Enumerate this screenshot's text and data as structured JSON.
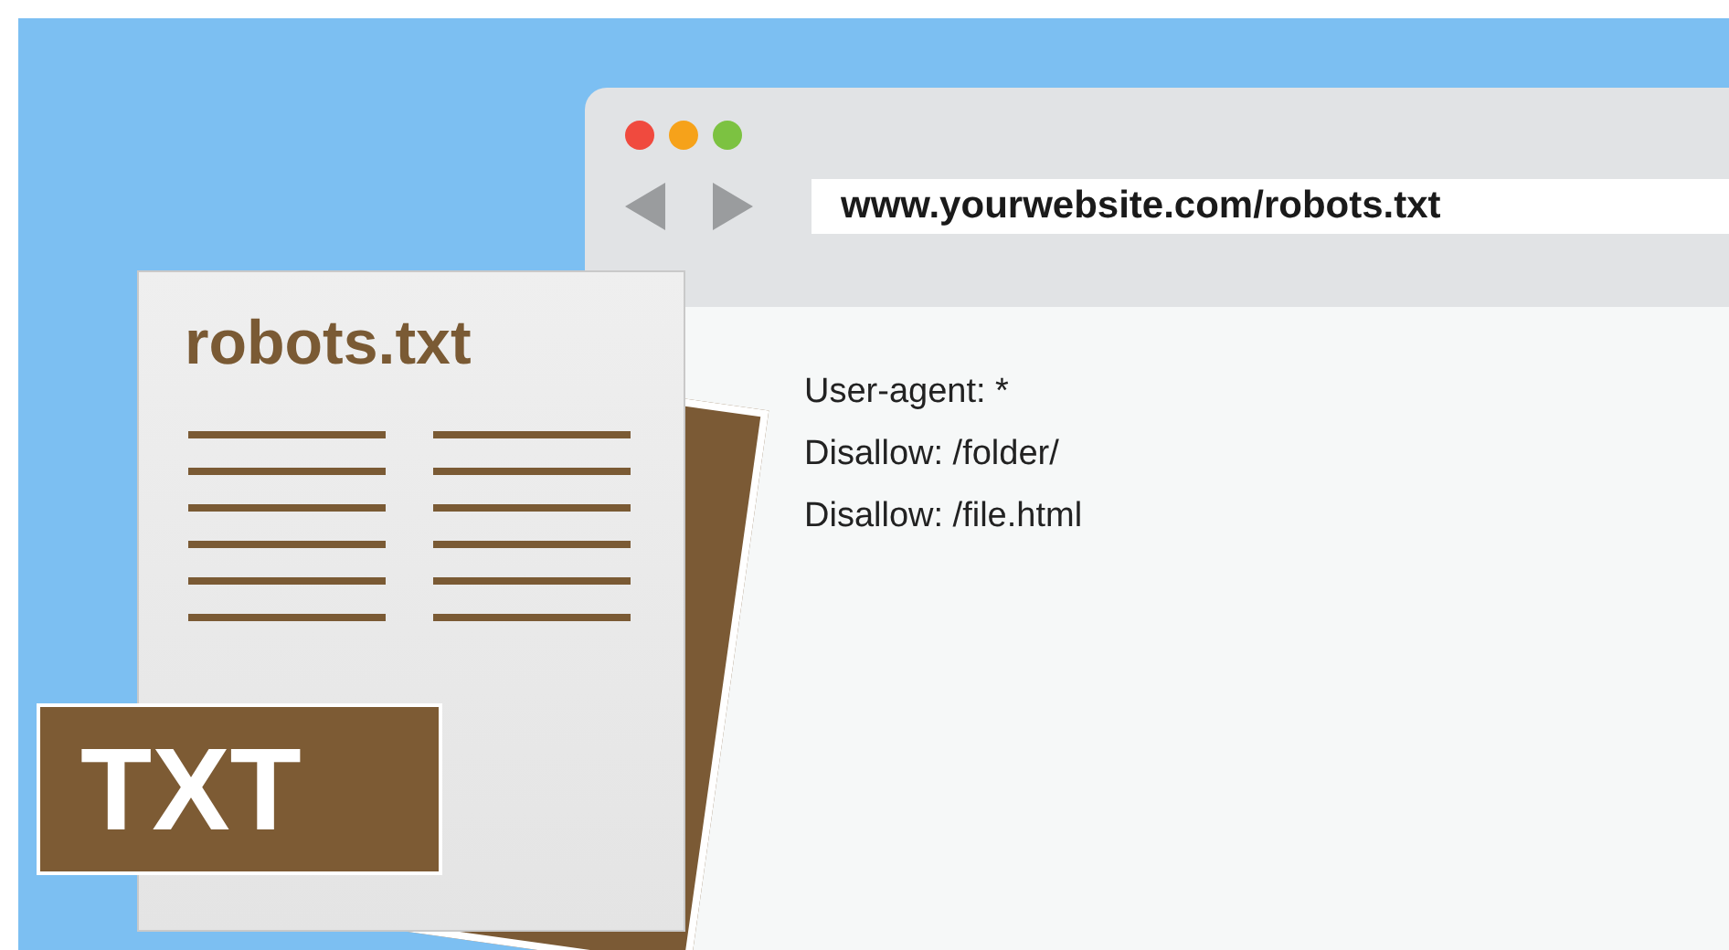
{
  "browser": {
    "address": "www.yourwebsite.com/robots.txt",
    "content_lines": [
      "User-agent: *",
      "Disallow: /folder/",
      "Disallow: /file.html"
    ]
  },
  "file_icon": {
    "title": "robots.txt",
    "badge": "TXT"
  }
}
